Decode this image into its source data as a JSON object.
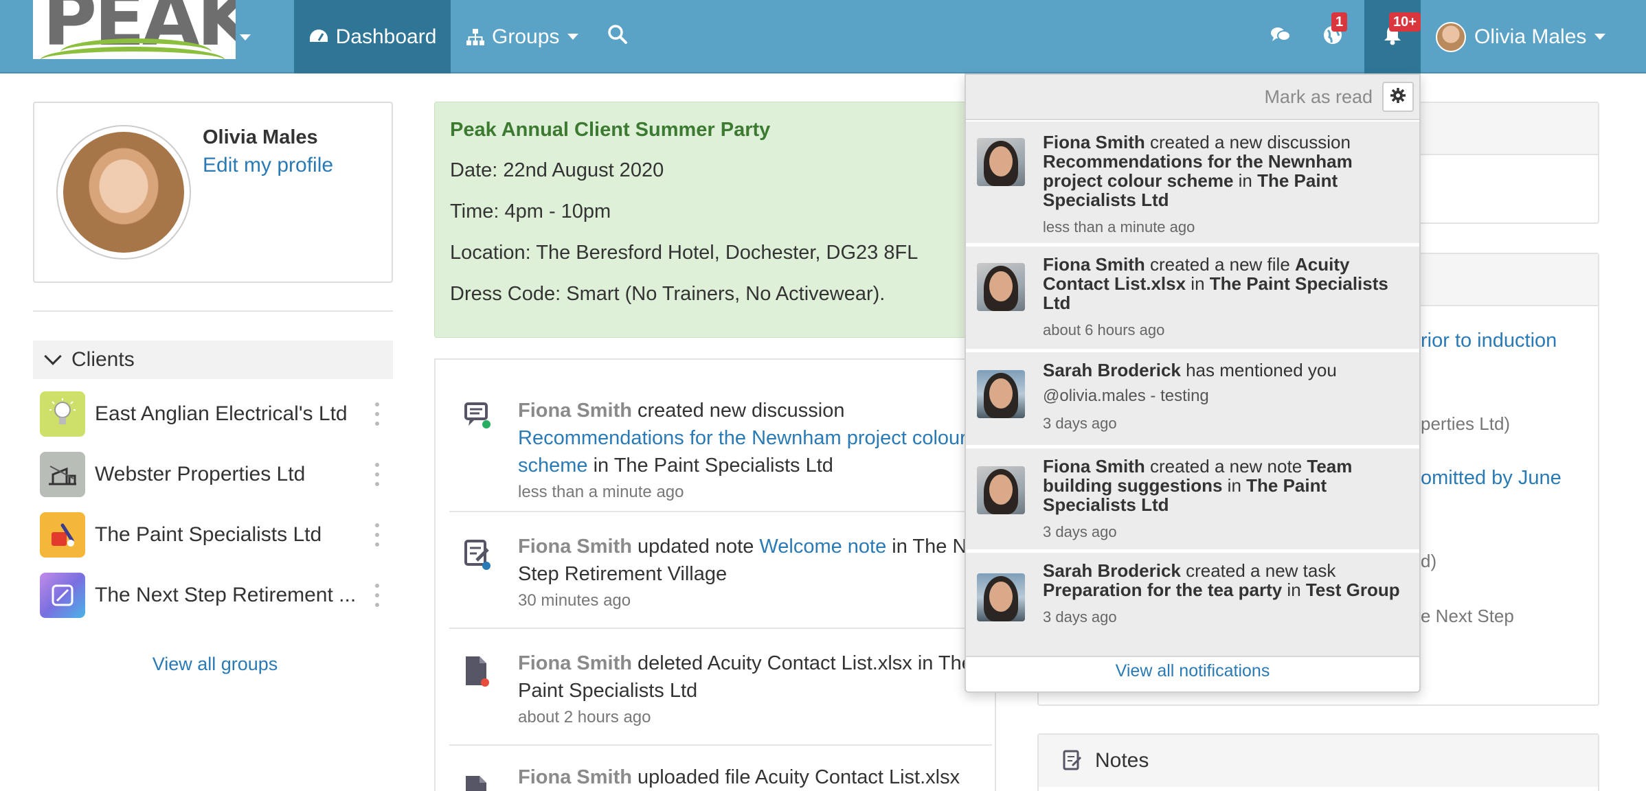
{
  "navbar": {
    "logo_text": "PEAK",
    "dashboard_label": "Dashboard",
    "groups_label": "Groups",
    "globe_badge": "1",
    "bell_badge": "10+",
    "user_name": "Olivia Males",
    "colors": {
      "bar": "#5aa3c6",
      "active": "#2f7696",
      "badge": "#d9363e"
    }
  },
  "profile": {
    "name": "Olivia Males",
    "edit_label": "Edit my profile"
  },
  "clients": {
    "header": "Clients",
    "items": [
      {
        "name": "East Anglian Electrical's Ltd",
        "icon": "lightbulb-icon"
      },
      {
        "name": "Webster Properties Ltd",
        "icon": "building-icon"
      },
      {
        "name": "The Paint Specialists Ltd",
        "icon": "paint-icon"
      },
      {
        "name": "The Next Step Retirement ...",
        "icon": "gradient-icon"
      }
    ],
    "view_all": "View all groups"
  },
  "event": {
    "title": "Peak Annual Client Summer Party",
    "date": "Date: 22nd August 2020",
    "time": "Time: 4pm - 10pm",
    "location": "Location: The Beresford Hotel, Dochester, DG23 8FL",
    "dress": "Dress Code: Smart (No Trainers, No Activewear)."
  },
  "feed": [
    {
      "who": "Fiona Smith",
      "action": " created new discussion ",
      "link": "Recommendations for the Newnham project colour scheme",
      "rest": " in The Paint Specialists Ltd",
      "time": "less than a minute ago",
      "icon": "discussion-icon"
    },
    {
      "who": "Fiona Smith",
      "action": " updated note ",
      "link": "Welcome note",
      "rest": " in The Next Step Retirement Village",
      "time": "30 minutes ago",
      "icon": "note-edit-icon"
    },
    {
      "who": "Fiona Smith",
      "action": " deleted Acuity Contact List.xlsx in The Paint Specialists Ltd",
      "link": "",
      "rest": "",
      "time": "about 2 hours ago",
      "icon": "file-icon"
    },
    {
      "who": "Fiona Smith",
      "action": " uploaded file Acuity Contact List.xlsx",
      "link": "",
      "rest": "",
      "time": "",
      "icon": "file-icon"
    }
  ],
  "right_column": {
    "link1": "rior to induction",
    "text1": "perties Ltd)",
    "link2": "omitted by June",
    "text2": "d)",
    "text3": "e Next Step",
    "notes_title": "Notes"
  },
  "notifications": {
    "mark_read": "Mark as read",
    "items": [
      {
        "who": "Fiona Smith",
        "verb": " created a new discussion ",
        "obj": "Recommendations for the Newnham project colour scheme",
        "in": " in ",
        "group": "The Paint Specialists Ltd",
        "sub": "",
        "time": "less than a minute ago"
      },
      {
        "who": "Fiona Smith",
        "verb": " created a new file ",
        "obj": "Acuity Contact List.xlsx",
        "in": " in ",
        "group": "The Paint Specialists Ltd",
        "sub": "",
        "time": "about 6 hours ago"
      },
      {
        "who": "Sarah Broderick",
        "verb": " has mentioned you",
        "obj": "",
        "in": "",
        "group": "",
        "sub": "@olivia.males - testing",
        "time": "3 days ago"
      },
      {
        "who": "Fiona Smith",
        "verb": " created a new note ",
        "obj": "Team building suggestions",
        "in": " in ",
        "group": "The Paint Specialists Ltd",
        "sub": "",
        "time": "3 days ago"
      },
      {
        "who": "Sarah Broderick",
        "verb": " created a new task ",
        "obj": "Preparation for the tea party",
        "in": " in ",
        "group": "Test Group",
        "sub": "",
        "time": "3 days ago"
      }
    ],
    "view_all": "View all notifications"
  }
}
